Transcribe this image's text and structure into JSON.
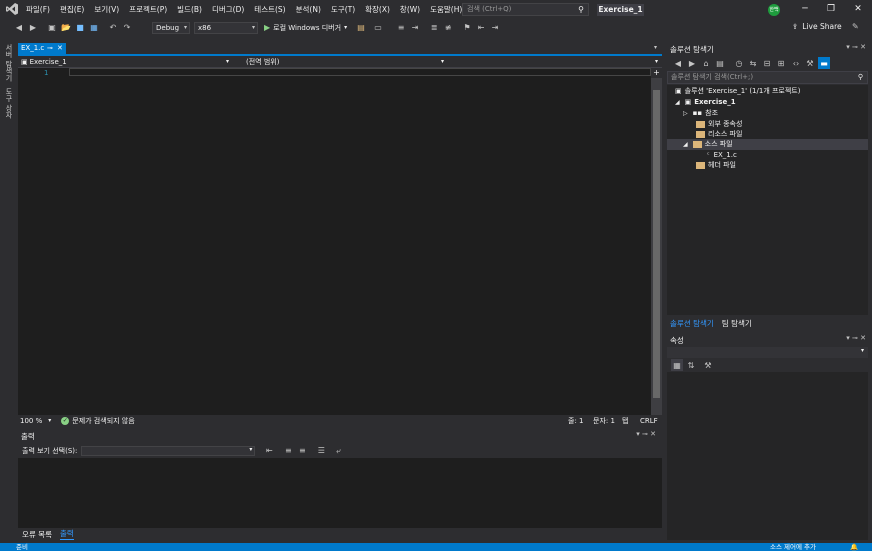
{
  "menu": [
    "파일(F)",
    "편집(E)",
    "보기(V)",
    "프로젝트(P)",
    "빌드(B)",
    "디버그(D)",
    "테스트(S)",
    "분석(N)",
    "도구(T)",
    "확장(X)",
    "창(W)",
    "도움말(H)"
  ],
  "search": {
    "placeholder": "검색 (Ctrl+Q)"
  },
  "window_title": "Exercise_1",
  "avatar_initials": "한백",
  "toolbar": {
    "config": "Debug",
    "platform": "x86",
    "run_label": "로컬 Windows 디버거",
    "live_share": "Live Share"
  },
  "left_strip": {
    "tab1": "서버 탐색기",
    "tab2": "도구 상자"
  },
  "editor": {
    "tab_label": "EX_1.c",
    "nav_project": "Exercise_1",
    "nav_scope": "(전역 범위)",
    "line_number": "1"
  },
  "editor_status": {
    "zoom": "100 %",
    "issues": "문제가 검색되지 않음",
    "line": "줄: 1",
    "col": "문자: 1",
    "tab": "탭",
    "eol": "CRLF"
  },
  "output": {
    "title": "출력",
    "source_label": "출력 보기 선택(S):",
    "tabs": [
      "오류 목록",
      "출력"
    ]
  },
  "solution_explorer": {
    "title": "솔루션 탐색기",
    "search_placeholder": "솔루션 탐색기 검색(Ctrl+;)",
    "items": [
      {
        "label": "솔루션 'Exercise_1' (1/1개 프로젝트)"
      },
      {
        "label": "Exercise_1"
      },
      {
        "label": "참조"
      },
      {
        "label": "외부 종속성"
      },
      {
        "label": "리소스 파일"
      },
      {
        "label": "소스 파일"
      },
      {
        "label": "EX_1.c"
      },
      {
        "label": "헤더 파일"
      }
    ],
    "tabs": [
      "솔루션 탐색기",
      "팀 탐색기"
    ]
  },
  "properties": {
    "title": "속성"
  },
  "statusbar": {
    "left": "준비",
    "right": "소스 제어에 추가"
  },
  "colors": {
    "accent": "#007acc",
    "background": "#2d2d30",
    "editor": "#1e1e1e",
    "folder": "#dcb67a"
  }
}
